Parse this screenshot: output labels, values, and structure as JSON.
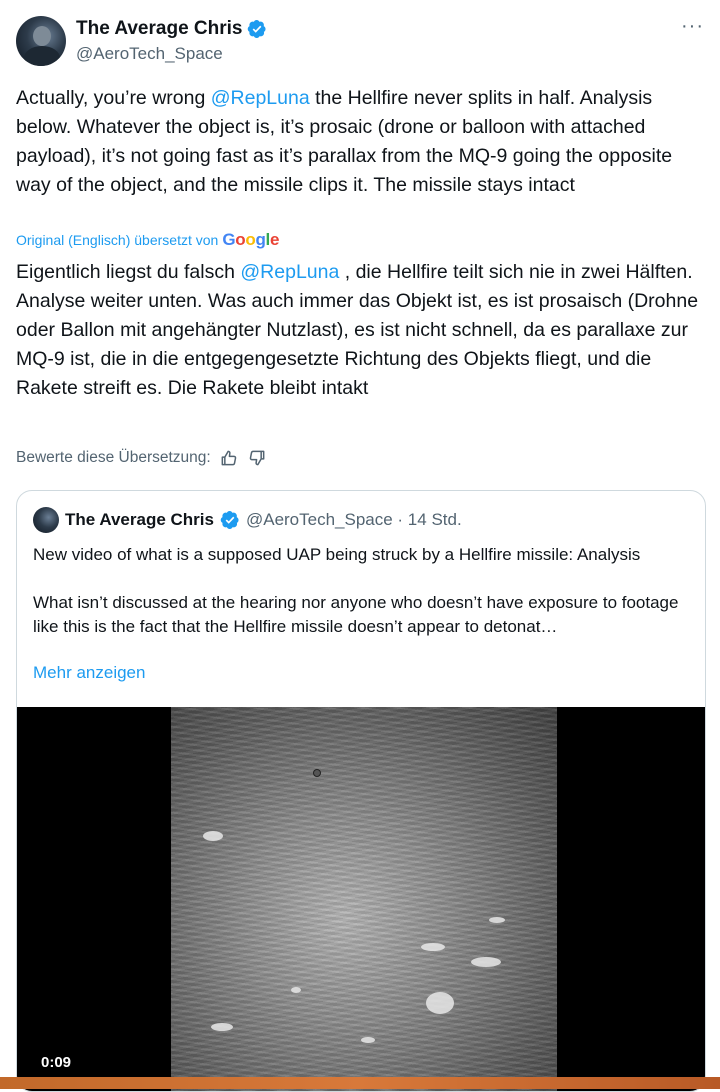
{
  "tweet": {
    "author_name": "The Average Chris",
    "author_handle": "@AeroTech_Space",
    "more_label": "···",
    "text_before": "Actually, you’re wrong ",
    "mention": "@RepLuna",
    "text_after": " the Hellfire never splits in half. Analysis below. Whatever the object is, it’s prosaic (drone or balloon with attached payload), it’s not going fast as it’s parallax from the MQ-9 going the opposite way of the object, and the missile clips it. The missile stays intact",
    "translated_label": "Original (Englisch) übersetzt von",
    "translation_before": "Eigentlich liegst du falsch ",
    "translation_mention": "@RepLuna",
    "translation_after": " , die Hellfire teilt sich nie in zwei Hälften. Analyse weiter unten. Was auch immer das Objekt ist, es ist prosaisch (Drohne oder Ballon mit angehängter Nutzlast), es ist nicht schnell, da es parallaxe zur MQ-9 ist, die in die entgegengesetzte Richtung des Objekts fliegt, und die Rakete streift es. Die Rakete bleibt intakt",
    "rate_label": "Bewerte diese Übersetzung:"
  },
  "google_logo": {
    "g1": "G",
    "o1": "o",
    "o2": "o",
    "g2": "g",
    "l": "l",
    "e": "e"
  },
  "quote": {
    "author_name": "The Average Chris",
    "meta": "@AeroTech_Space · 14 Std.",
    "line1": "New video of what is a supposed UAP being struck by a Hellfire missile: Analysis",
    "line2": "What isn’t discussed at the hearing nor anyone who doesn’t have exposure to footage like this is the fact that the Hellfire missile doesn’t appear to detonat…",
    "show_more": "Mehr anzeigen",
    "video_time": "0:09"
  },
  "colors": {
    "accent": "#1d9bf0",
    "text": "#0f1419",
    "muted": "#536471",
    "border": "#cfd9de"
  }
}
